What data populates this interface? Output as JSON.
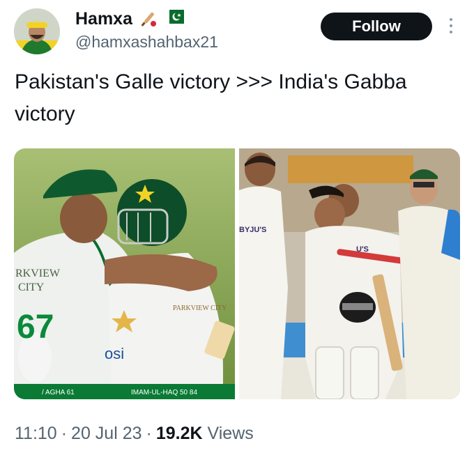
{
  "user": {
    "display_name": "Hamxa",
    "handle": "@hamxashahbax21",
    "badges": [
      "cricket-bat-emoji",
      "pakistan-flag-emoji"
    ]
  },
  "follow_button": {
    "label": "Follow"
  },
  "tweet": {
    "text": "Pakistan's Galle victory >>> India's Gabba victory"
  },
  "media": {
    "left_photo": {
      "sponsor_board_lines": [
        "RKVIEW",
        "CITY"
      ],
      "jersey_number": "67",
      "jersey_sponsor": "PARKVIEW CITY",
      "chest_logo": "osi",
      "scorebar": {
        "player1": "/ AGHA 61",
        "player2": "IMAM-UL-HAQ 50 84"
      }
    },
    "right_photo": {
      "shirt_sponsor": "BYJU'S",
      "shirt_sponsor_2": "U'S"
    }
  },
  "meta": {
    "time": "11:10",
    "separator": "·",
    "date": "20 Jul 23",
    "views_count": "19.2K",
    "views_label": "Views"
  },
  "colors": {
    "follow_bg": "#0f1419",
    "secondary_text": "#536471",
    "pakistan_green": "#0a6b2e"
  }
}
